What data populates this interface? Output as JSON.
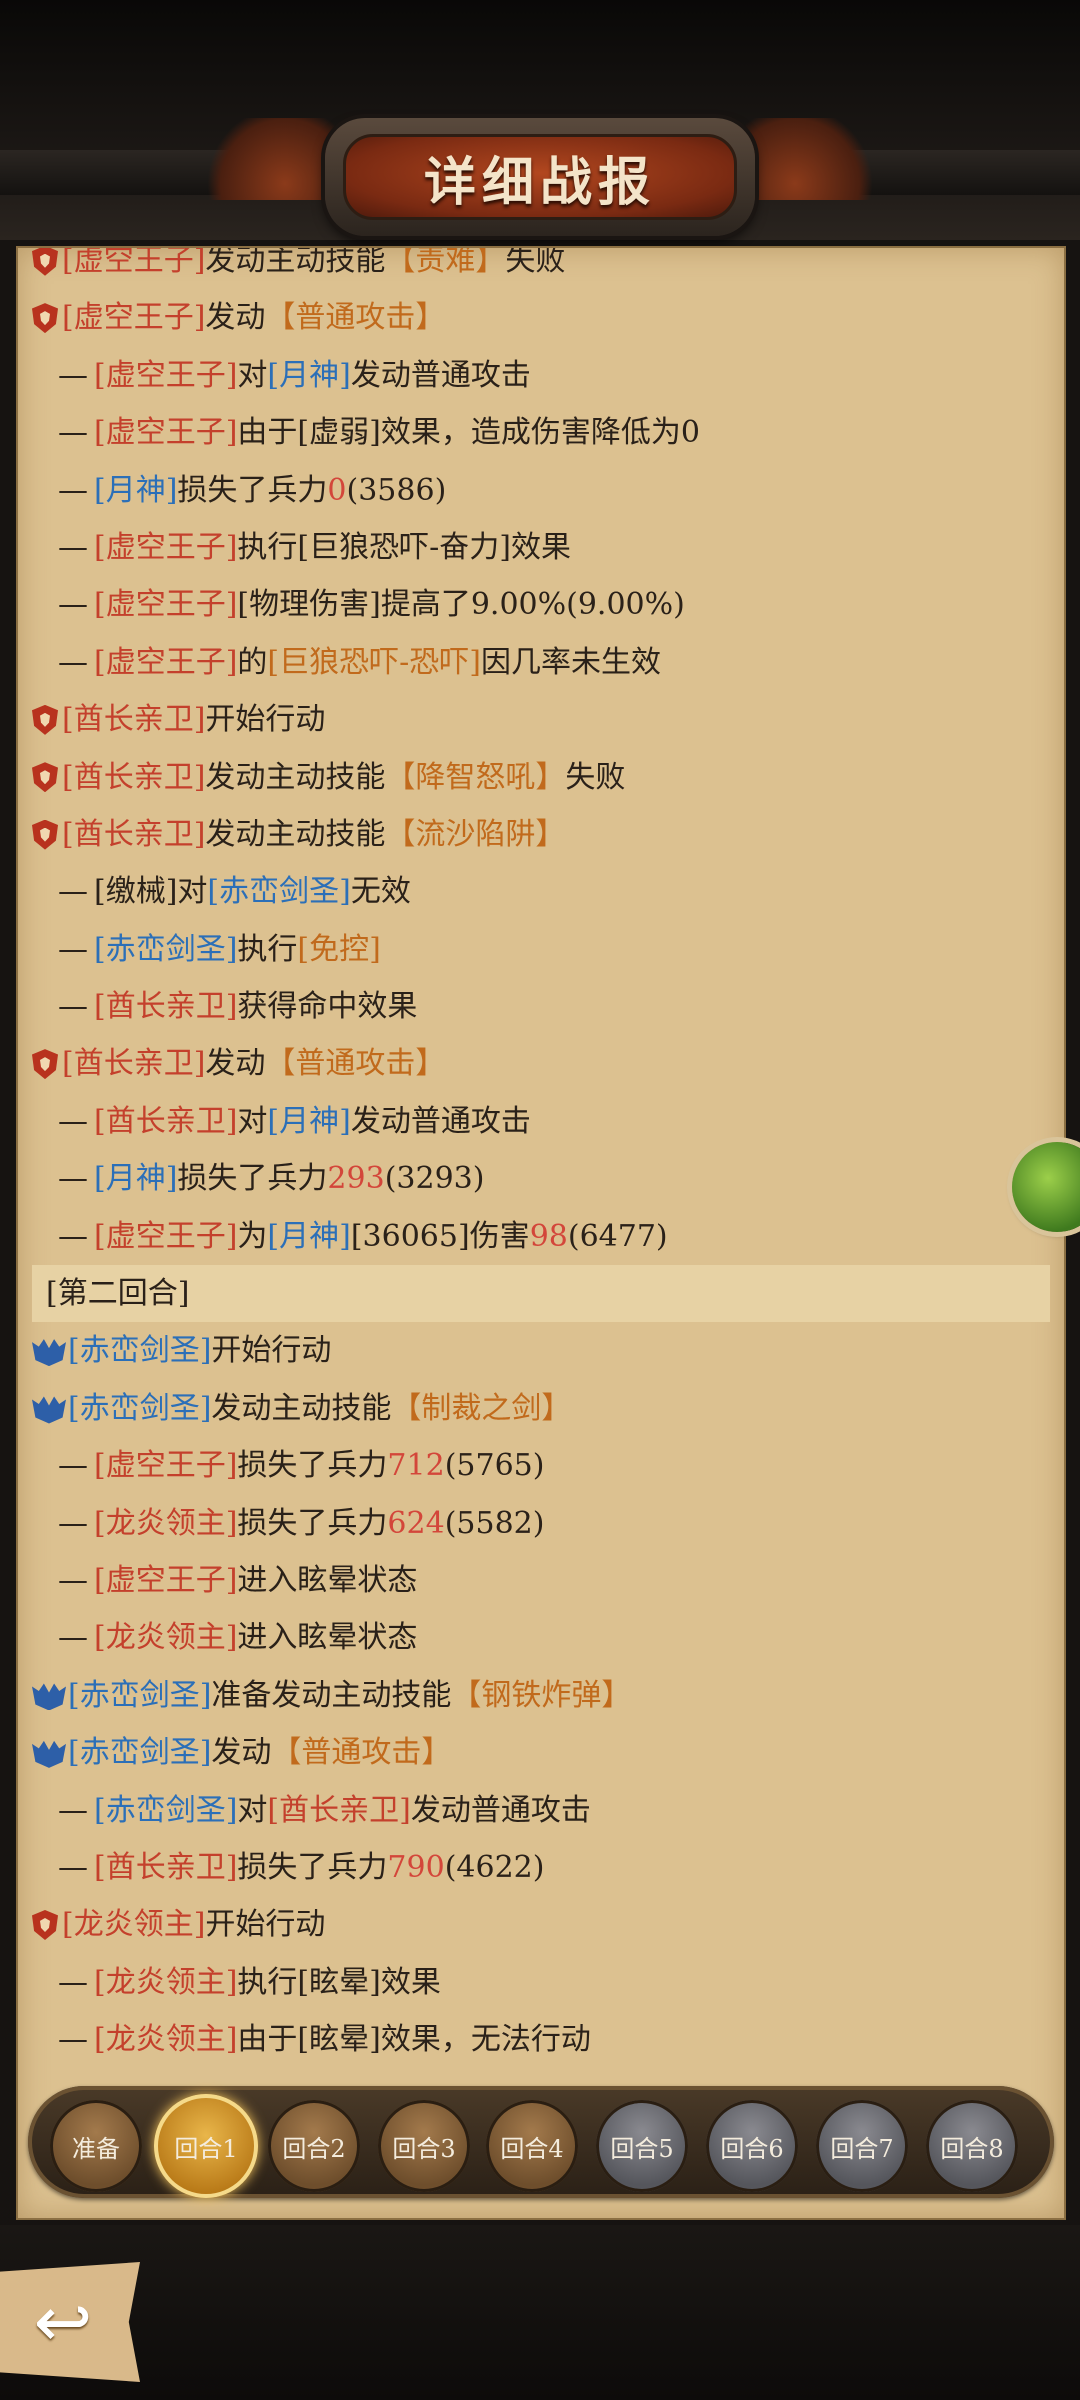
{
  "header": {
    "title": "详细战报"
  },
  "log": [
    {
      "type": "main",
      "icon": "shield",
      "parts": [
        [
          "red",
          "[虚空王子]"
        ],
        [
          "",
          "发动主动技能"
        ],
        [
          "org",
          "【责难】"
        ],
        [
          "",
          "失败"
        ]
      ]
    },
    {
      "type": "main",
      "icon": "shield",
      "parts": [
        [
          "red",
          "[虚空王子]"
        ],
        [
          "",
          "发动"
        ],
        [
          "org",
          "【普通攻击】"
        ]
      ]
    },
    {
      "type": "sub",
      "parts": [
        [
          "red",
          "[虚空王子]"
        ],
        [
          "",
          "对"
        ],
        [
          "blue",
          "[月神]"
        ],
        [
          "",
          "发动普通攻击"
        ]
      ]
    },
    {
      "type": "sub",
      "parts": [
        [
          "red",
          "[虚空王子]"
        ],
        [
          "",
          "由于[虚弱]效果，造成伤害降低为0"
        ]
      ]
    },
    {
      "type": "sub",
      "parts": [
        [
          "blue",
          "[月神]"
        ],
        [
          "",
          "损失了兵力"
        ],
        [
          "num",
          "0"
        ],
        [
          "",
          "(3586)"
        ]
      ]
    },
    {
      "type": "sub",
      "parts": [
        [
          "red",
          "[虚空王子]"
        ],
        [
          "",
          "执行[巨狼恐吓-奋力]效果"
        ]
      ]
    },
    {
      "type": "sub",
      "parts": [
        [
          "red",
          "[虚空王子]"
        ],
        [
          "",
          "[物理伤害]提高了9.00%(9.00%)"
        ]
      ]
    },
    {
      "type": "sub",
      "parts": [
        [
          "red",
          "[虚空王子]"
        ],
        [
          "",
          "的"
        ],
        [
          "org",
          "[巨狼恐吓-恐吓]"
        ],
        [
          "",
          "因几率未生效"
        ]
      ]
    },
    {
      "type": "main",
      "icon": "shield",
      "parts": [
        [
          "red",
          "[酋长亲卫]"
        ],
        [
          "",
          "开始行动"
        ]
      ]
    },
    {
      "type": "main",
      "icon": "shield",
      "parts": [
        [
          "red",
          "[酋长亲卫]"
        ],
        [
          "",
          "发动主动技能"
        ],
        [
          "org",
          "【降智怒吼】"
        ],
        [
          "",
          "失败"
        ]
      ]
    },
    {
      "type": "main",
      "icon": "shield",
      "parts": [
        [
          "red",
          "[酋长亲卫]"
        ],
        [
          "",
          "发动主动技能"
        ],
        [
          "org",
          "【流沙陷阱】"
        ]
      ]
    },
    {
      "type": "sub",
      "parts": [
        [
          "",
          "[缴械]对"
        ],
        [
          "blue",
          "[赤峦剑圣]"
        ],
        [
          "",
          "无效"
        ]
      ]
    },
    {
      "type": "sub",
      "parts": [
        [
          "blue",
          "[赤峦剑圣]"
        ],
        [
          "",
          "执行"
        ],
        [
          "org",
          "[免控]"
        ]
      ]
    },
    {
      "type": "sub",
      "parts": [
        [
          "red",
          "[酋长亲卫]"
        ],
        [
          "",
          "获得命中效果"
        ]
      ]
    },
    {
      "type": "main",
      "icon": "shield",
      "parts": [
        [
          "red",
          "[酋长亲卫]"
        ],
        [
          "",
          "发动"
        ],
        [
          "org",
          "【普通攻击】"
        ]
      ]
    },
    {
      "type": "sub",
      "parts": [
        [
          "red",
          "[酋长亲卫]"
        ],
        [
          "",
          "对"
        ],
        [
          "blue",
          "[月神]"
        ],
        [
          "",
          "发动普通攻击"
        ]
      ]
    },
    {
      "type": "sub",
      "parts": [
        [
          "blue",
          "[月神]"
        ],
        [
          "",
          "损失了兵力"
        ],
        [
          "num",
          "293"
        ],
        [
          "",
          "(3293)"
        ]
      ]
    },
    {
      "type": "sub",
      "parts": [
        [
          "red",
          "[虚空王子]"
        ],
        [
          "",
          "为"
        ],
        [
          "blue",
          "[月神]"
        ],
        [
          "",
          "[36065]伤害"
        ],
        [
          "num",
          "98"
        ],
        [
          "",
          "(6477)"
        ]
      ]
    },
    {
      "type": "round",
      "parts": [
        [
          "",
          "[第二回合]"
        ]
      ]
    },
    {
      "type": "main",
      "icon": "bat",
      "parts": [
        [
          "blue",
          "[赤峦剑圣]"
        ],
        [
          "",
          "开始行动"
        ]
      ]
    },
    {
      "type": "main",
      "icon": "bat",
      "parts": [
        [
          "blue",
          "[赤峦剑圣]"
        ],
        [
          "",
          "发动主动技能"
        ],
        [
          "org",
          "【制裁之剑】"
        ]
      ]
    },
    {
      "type": "sub",
      "parts": [
        [
          "red",
          "[虚空王子]"
        ],
        [
          "",
          "损失了兵力"
        ],
        [
          "num",
          "712"
        ],
        [
          "",
          "(5765)"
        ]
      ]
    },
    {
      "type": "sub",
      "parts": [
        [
          "red",
          "[龙炎领主]"
        ],
        [
          "",
          "损失了兵力"
        ],
        [
          "num",
          "624"
        ],
        [
          "",
          "(5582)"
        ]
      ]
    },
    {
      "type": "sub",
      "parts": [
        [
          "red",
          "[虚空王子]"
        ],
        [
          "",
          "进入眩晕状态"
        ]
      ]
    },
    {
      "type": "sub",
      "parts": [
        [
          "red",
          "[龙炎领主]"
        ],
        [
          "",
          "进入眩晕状态"
        ]
      ]
    },
    {
      "type": "main",
      "icon": "bat",
      "parts": [
        [
          "blue",
          "[赤峦剑圣]"
        ],
        [
          "",
          "准备发动主动技能"
        ],
        [
          "org",
          "【钢铁炸弹】"
        ]
      ]
    },
    {
      "type": "main",
      "icon": "bat",
      "parts": [
        [
          "blue",
          "[赤峦剑圣]"
        ],
        [
          "",
          "发动"
        ],
        [
          "org",
          "【普通攻击】"
        ]
      ]
    },
    {
      "type": "sub",
      "parts": [
        [
          "blue",
          "[赤峦剑圣]"
        ],
        [
          "",
          "对"
        ],
        [
          "red",
          "[酋长亲卫]"
        ],
        [
          "",
          "发动普通攻击"
        ]
      ]
    },
    {
      "type": "sub",
      "parts": [
        [
          "red",
          "[酋长亲卫]"
        ],
        [
          "",
          "损失了兵力"
        ],
        [
          "num",
          "790"
        ],
        [
          "",
          "(4622)"
        ]
      ]
    },
    {
      "type": "main",
      "icon": "shield",
      "parts": [
        [
          "red",
          "[龙炎领主]"
        ],
        [
          "",
          "开始行动"
        ]
      ]
    },
    {
      "type": "sub",
      "parts": [
        [
          "red",
          "[龙炎领主]"
        ],
        [
          "",
          "执行[眩晕]效果"
        ]
      ]
    },
    {
      "type": "sub",
      "parts": [
        [
          "red",
          "[龙炎领主]"
        ],
        [
          "",
          "由于[眩晕]效果，无法行动"
        ]
      ]
    }
  ],
  "rounds": [
    {
      "label": "准备",
      "style": "bronze"
    },
    {
      "label": "回合1",
      "style": "active"
    },
    {
      "label": "回合2",
      "style": "bronze"
    },
    {
      "label": "回合3",
      "style": "bronze"
    },
    {
      "label": "回合4",
      "style": "bronze"
    },
    {
      "label": "回合5",
      "style": "gray"
    },
    {
      "label": "回合6",
      "style": "gray"
    },
    {
      "label": "回合7",
      "style": "gray"
    },
    {
      "label": "回合8",
      "style": "gray"
    }
  ],
  "icons": {
    "back": "back-arrow-icon",
    "side": "green-emblem-icon"
  }
}
